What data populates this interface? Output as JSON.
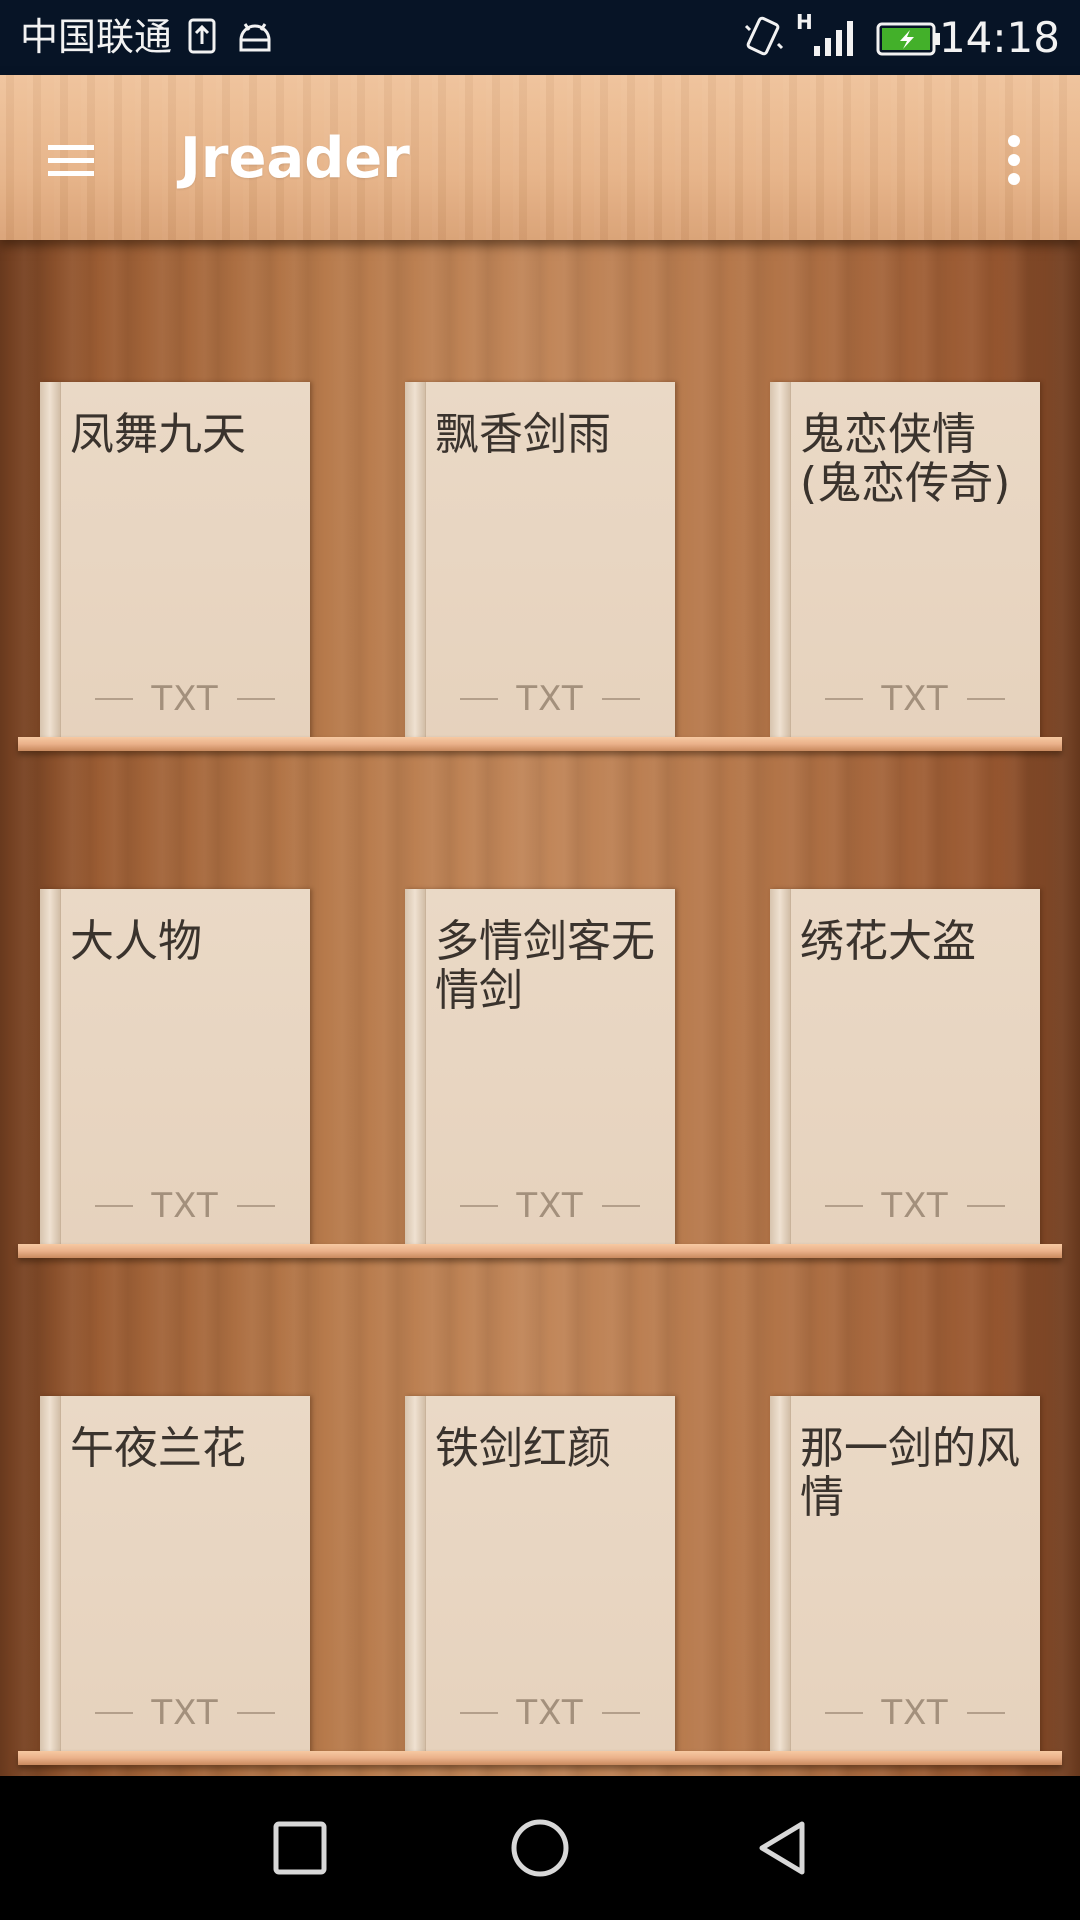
{
  "status_bar": {
    "carrier": "中国联通",
    "time": "14:18",
    "network_type": "H",
    "icons": [
      "upload-icon",
      "android-icon",
      "vibrate-icon",
      "signal-icon",
      "battery-charging-icon"
    ]
  },
  "app_bar": {
    "title": "Jreader",
    "menu_icon": "hamburger-menu-icon",
    "overflow_icon": "more-vert-icon"
  },
  "shelves": [
    {
      "books": [
        {
          "title": "凤舞九天",
          "format": "TXT"
        },
        {
          "title": "飘香剑雨",
          "format": "TXT"
        },
        {
          "title": "鬼恋侠情(鬼恋传奇)",
          "format": "TXT"
        }
      ]
    },
    {
      "books": [
        {
          "title": "大人物",
          "format": "TXT"
        },
        {
          "title": "多情剑客无情剑",
          "format": "TXT"
        },
        {
          "title": "绣花大盗",
          "format": "TXT"
        }
      ]
    },
    {
      "books": [
        {
          "title": "午夜兰花",
          "format": "TXT"
        },
        {
          "title": "铁剑红颜",
          "format": "TXT"
        },
        {
          "title": "那一剑的风情",
          "format": "TXT"
        }
      ]
    }
  ],
  "nav_bar": {
    "icons": [
      "recents-square-icon",
      "home-circle-icon",
      "back-triangle-icon"
    ]
  },
  "colors": {
    "status_bar_bg": "#071426",
    "app_title": "#ffffff",
    "book_cover": "#e8d5c0",
    "book_title": "#3a332d",
    "book_format": "#a3907c"
  }
}
